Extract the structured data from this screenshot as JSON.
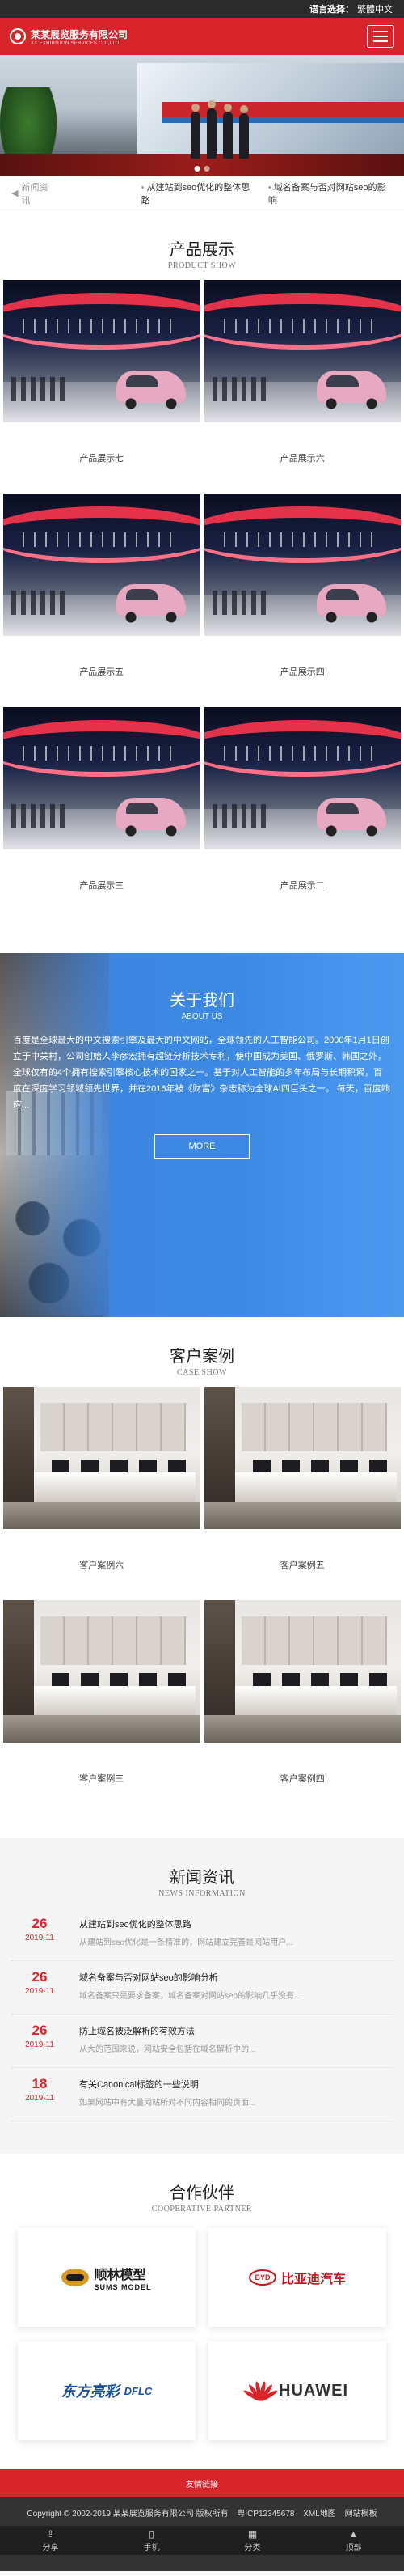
{
  "topbar": {
    "lang_label": "语言选择：",
    "lang_value": "繁體中文"
  },
  "header": {
    "company_cn": "某某展览服务有限公司",
    "company_en": "XX EXHIBITION SERVICES CO.,LTD"
  },
  "ticker": {
    "label": "新闻资讯",
    "items": [
      "从建站到seo优化的整体思路",
      "域名备案与否对网站seo的影响"
    ]
  },
  "products": {
    "title_cn": "产品展示",
    "title_en": "PRODUCT SHOW",
    "items": [
      "产品展示七",
      "产品展示六",
      "产品展示五",
      "产品展示四",
      "产品展示三",
      "产品展示二"
    ]
  },
  "about": {
    "title_cn": "关于我们",
    "title_en": "ABOUT US",
    "text": "百度是全球最大的中文搜索引擎及最大的中文网站，全球领先的人工智能公司。2000年1月1日创立于中关村，公司创始人李彦宏拥有超链分析技术专利，使中国成为美国、俄罗斯、韩国之外，全球仅有的4个拥有搜索引擎核心技术的国家之一。基于对人工智能的多年布局与长期积累，百度在深度学习领域领先世界，并在2016年被《财富》杂志称为全球AI四巨头之一。 每天，百度响应...",
    "more": "MORE"
  },
  "cases": {
    "title_cn": "客户案例",
    "title_en": "CASE SHOW",
    "items": [
      "客户案例六",
      "客户案例五",
      "客户案例三",
      "客户案例四"
    ]
  },
  "news": {
    "title_cn": "新闻资讯",
    "title_en": "NEWS INFORMATION",
    "items": [
      {
        "day": "26",
        "ym": "2019-11",
        "title": "从建站到seo优化的整体思路",
        "desc": "从建站到seo优化是一条精准的，网站建立完善是网站用户..."
      },
      {
        "day": "26",
        "ym": "2019-11",
        "title": "域名备案与否对网站seo的影响分析",
        "desc": "域名备案只是要求备案，域名备案对网站seo的影响几乎没有..."
      },
      {
        "day": "26",
        "ym": "2019-11",
        "title": "防止域名被泛解析的有效方法",
        "desc": "从大的范围来说，网站安全包括在域名解析中的..."
      },
      {
        "day": "18",
        "ym": "2019-11",
        "title": "有关Canonical标签的一些说明",
        "desc": "如果网站中有大量网站所对不同内容相同的页面..."
      }
    ]
  },
  "partners": {
    "title_cn": "合作伙伴",
    "title_en": "COOPERATIVE PARTNER",
    "items": [
      {
        "name": "顺林模型",
        "sub": "SUMS MODEL"
      },
      {
        "name": "比亚迪汽车",
        "sub": "BYD"
      },
      {
        "name": "东方亮彩",
        "sub": "DFLC"
      },
      {
        "name": "HUAWEI",
        "sub": ""
      }
    ]
  },
  "links": {
    "label": "友情链接"
  },
  "footer": {
    "copyright": "Copyright © 2002-2019 某某展览服务有限公司 版权所有",
    "icp": "粤ICP12345678",
    "xml": "XML地图",
    "template": "网站模板"
  },
  "bottom_nav": [
    "分享",
    "手机",
    "分类",
    "顶部"
  ]
}
